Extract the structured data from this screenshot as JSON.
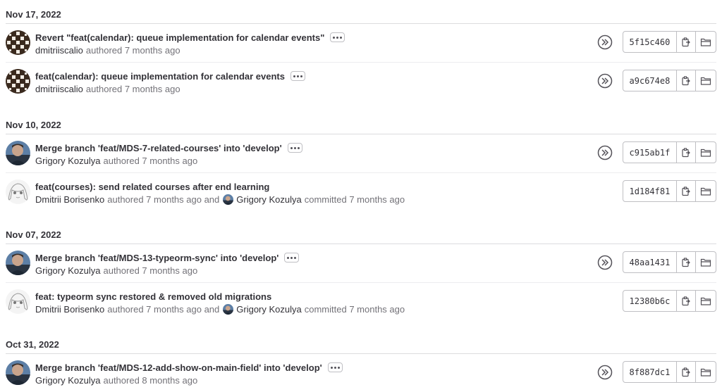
{
  "groups": [
    {
      "date": "Nov 17, 2022",
      "commits": [
        {
          "title": "Revert \"feat(calendar): queue implementation for calendar events\"",
          "author": "dmitriiscalio",
          "authored": "authored 7 months ago",
          "has_ellipsis": true,
          "has_pipeline": true,
          "sha": "5f15c460",
          "avatar": "pattern-avatar"
        },
        {
          "title": "feat(calendar): queue implementation for calendar events",
          "author": "dmitriiscalio",
          "authored": "authored 7 months ago",
          "has_ellipsis": true,
          "has_pipeline": true,
          "sha": "a9c674e8",
          "avatar": "pattern-avatar"
        }
      ]
    },
    {
      "date": "Nov 10, 2022",
      "commits": [
        {
          "title": "Merge branch 'feat/MDS-7-related-courses' into 'develop'",
          "author": "Grigory Kozulya",
          "authored": "authored 7 months ago",
          "has_ellipsis": true,
          "has_pipeline": true,
          "sha": "c915ab1f",
          "avatar": "photo-avatar"
        },
        {
          "title": "feat(courses): send related courses after end learning",
          "author": "Dmitrii Borisenko",
          "authored": "authored 7 months ago and",
          "committer": "Grigory Kozulya",
          "committed": "committed 7 months ago",
          "has_ellipsis": false,
          "has_pipeline": false,
          "sha": "1d184f81",
          "avatar": "anime-avatar"
        }
      ]
    },
    {
      "date": "Nov 07, 2022",
      "commits": [
        {
          "title": "Merge branch 'feat/MDS-13-typeorm-sync' into 'develop'",
          "author": "Grigory Kozulya",
          "authored": "authored 7 months ago",
          "has_ellipsis": true,
          "has_pipeline": true,
          "sha": "48aa1431",
          "avatar": "photo-avatar"
        },
        {
          "title": "feat: typeorm sync restored & removed old migrations",
          "author": "Dmitrii Borisenko",
          "authored": "authored 7 months ago and",
          "committer": "Grigory Kozulya",
          "committed": "committed 7 months ago",
          "has_ellipsis": false,
          "has_pipeline": false,
          "sha": "12380b6c",
          "avatar": "anime-avatar"
        }
      ]
    },
    {
      "date": "Oct 31, 2022",
      "commits": [
        {
          "title": "Merge branch 'feat/MDS-12-add-show-on-main-field' into 'develop'",
          "author": "Grigory Kozulya",
          "authored": "authored 8 months ago",
          "has_ellipsis": true,
          "has_pipeline": true,
          "sha": "8f887dc1",
          "avatar": "photo-avatar"
        }
      ]
    }
  ],
  "icons": {
    "pipeline": "pipeline-skipped-icon",
    "copy": "copy-to-clipboard-icon",
    "browse": "folder-open-icon",
    "ellipsis": "ellipsis-icon"
  },
  "colors": {
    "text": "#333238",
    "muted": "#737278",
    "border": "#bfbfc3"
  }
}
